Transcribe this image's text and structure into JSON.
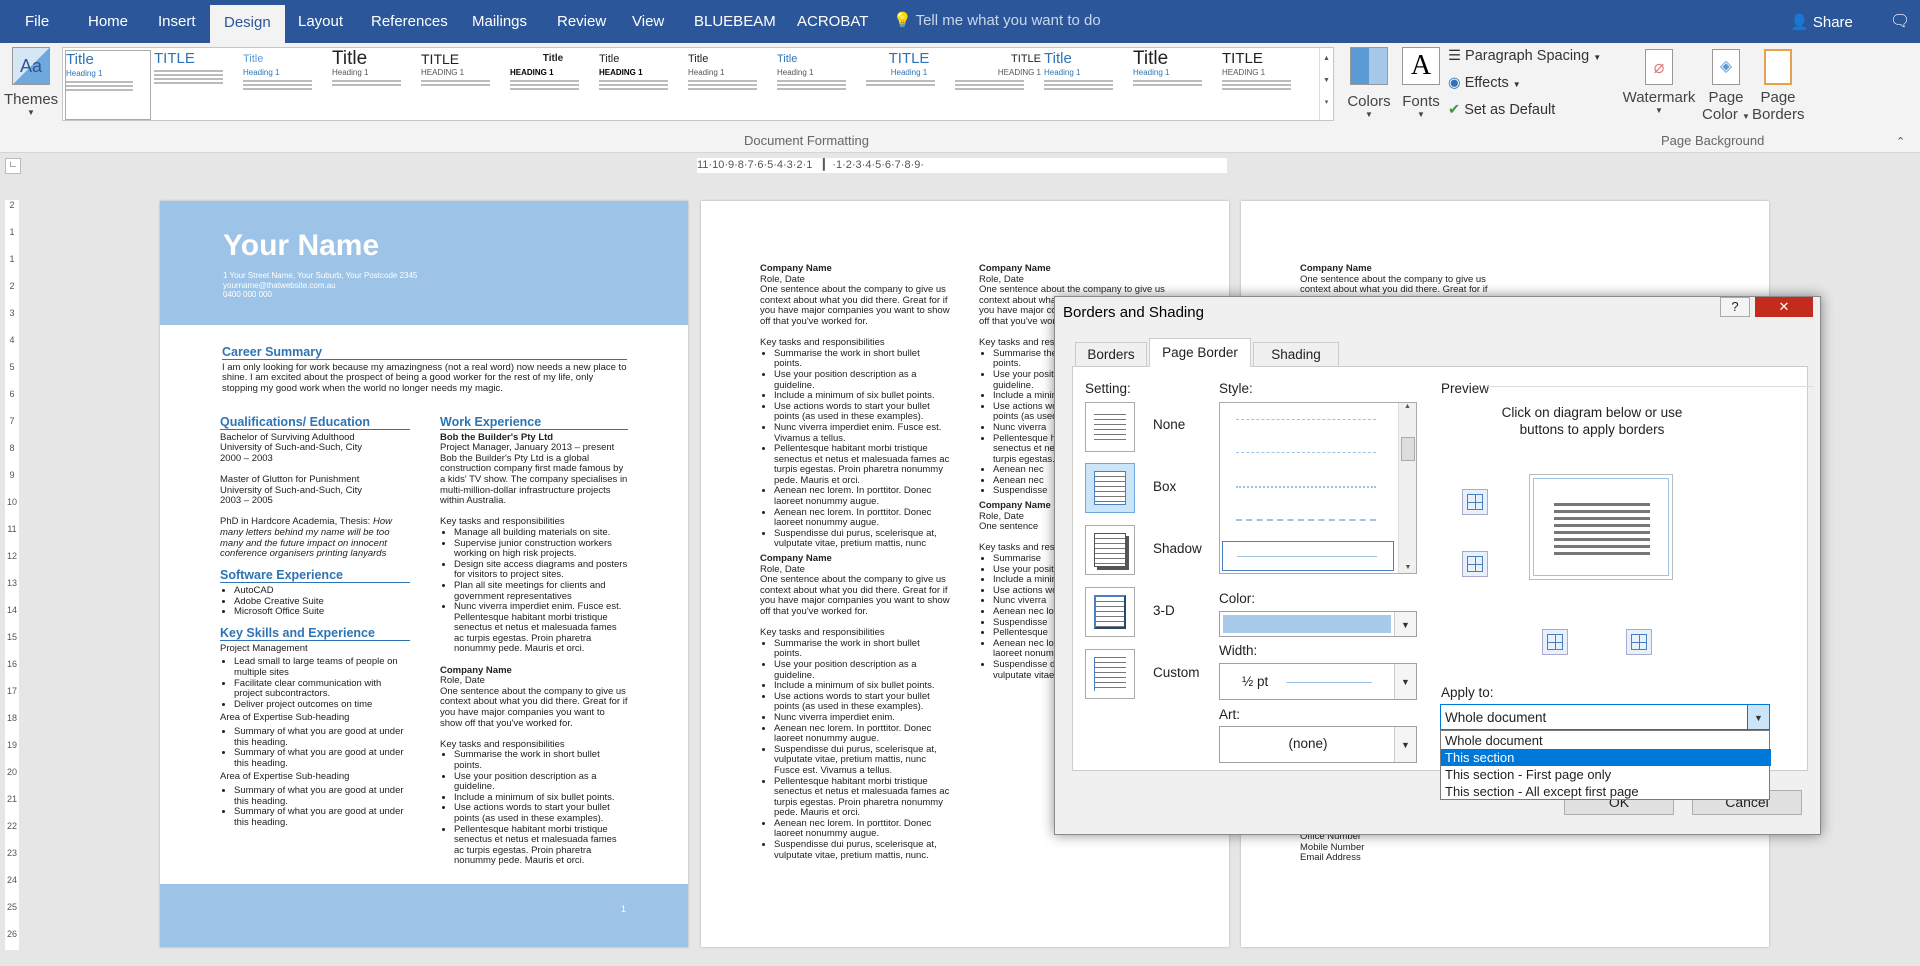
{
  "ribbon_tabs": [
    "File",
    "Home",
    "Insert",
    "Design",
    "Layout",
    "References",
    "Mailings",
    "Review",
    "View",
    "BLUEBEAM",
    "ACROBAT"
  ],
  "active_tab": "Design",
  "tell_me": "Tell me what you want to do",
  "share": "Share",
  "ribbon": {
    "themes": "Themes",
    "gallery_title": "Title",
    "gallery_title_caps": "TITLE",
    "gallery_heading": "Heading 1",
    "gallery_heading_caps": "HEADING 1",
    "colors": "Colors",
    "fonts": "Fonts",
    "paragraph_spacing": "Paragraph Spacing",
    "effects": "Effects",
    "set_default": "Set as Default",
    "doc_formatting_label": "Document Formatting",
    "watermark": "Watermark",
    "page_color_1": "Page",
    "page_color_2": "Color",
    "page_borders_1": "Page",
    "page_borders_2": "Borders",
    "page_background_label": "Page Background"
  },
  "ruler_text": "11·10·9·8·7·6·5·4·3·2·1 ▕▏·1·2·3·4·5·6·7·8·9·",
  "page1": {
    "name": "Your Name",
    "address": "1 Your Street Name, Your Suburb, Your Postcode 2345",
    "email": "yourname@thatwebsite.com.au",
    "phone": "0400 000 000",
    "career_summary_h": "Career Summary",
    "career_summary": "I am only looking for work because my amazingness (not a real word) now needs a new place to shine. I am excited about the prospect of being a good worker for the rest of my life, only stopping my good work when the world no longer needs my magic.",
    "qual_h": "Qualifications/ Education",
    "qual_1": [
      "Bachelor of Surviving Adulthood",
      "University of Such-and-Such, City",
      "2000 – 2003"
    ],
    "qual_2": [
      "Master of Glutton for Punishment",
      "University of Such-and-Such, City",
      "2003 – 2005"
    ],
    "qual_3_prefix": "PhD in Hardcore Academia, Thesis: ",
    "qual_3_thesis": "How many letters behind my name will be too many and the future impact on innocent conference organisers printing lanyards",
    "software_h": "Software Experience",
    "software": [
      "AutoCAD",
      "Adobe Creative Suite",
      "Microsoft Office Suite"
    ],
    "skills_h": "Key Skills and Experience",
    "skills_sub1": "Project Management",
    "skills_list1": [
      "Lead small to large teams of people on multiple sites",
      "Facilitate clear communication with project subcontractors.",
      "Deliver project outcomes on time"
    ],
    "skills_sub2": "Area of Expertise Sub-heading",
    "skills_list2": [
      "Summary of what you are good at under this heading.",
      "Summary of what you are good at under this heading."
    ],
    "skills_sub3": "Area of Expertise Sub-heading",
    "skills_list3": [
      "Summary of what you are good at under this heading.",
      "Summary of what you are good at under this heading."
    ],
    "work_h": "Work Experience",
    "work_company": "Bob the Builder's Pty Ltd",
    "work_role": "Project Manager, January 2013 – present",
    "work_desc": "Bob the Builder's Pty Ltd is a global construction company first made famous by a kids' TV show. The company specialises in multi-million-dollar infrastructure projects within Australia.",
    "tasks_h": "Key tasks and responsibilities",
    "work_tasks": [
      "Manage all building materials on site.",
      "Supervise junior construction workers working on high risk projects.",
      "Design site access diagrams and posters for visitors to project sites.",
      "Plan all site meetings for clients and government representatives",
      "Nunc viverra imperdiet enim. Fusce est. Pellentesque habitant morbi tristique senectus et netus et malesuada fames ac turpis egestas. Proin pharetra nonummy pede. Mauris et orci."
    ],
    "company2": "Company Name",
    "role2": "Role, Date",
    "desc2": "One sentence about the company to give us context about what you did there. Great for if you have major companies you want to show off that you've worked for.",
    "tasks2": [
      "Summarise the work in short bullet points.",
      "Use your position description as a guideline.",
      "Include a minimum of six bullet points.",
      "Use actions words to start your bullet points (as used in these examples).",
      "Pellentesque habitant morbi tristique senectus et netus et malesuada fames ac turpis egestas. Proin pharetra nonummy pede. Mauris et orci."
    ],
    "page_num": "1"
  },
  "page2": {
    "company": "Company Name",
    "role": "Role, Date",
    "desc": "One sentence about the company to give us context about what you did there. Great for if you have major companies you want to show off that you've worked for.",
    "tasks_h": "Key tasks and responsibilities",
    "tasks_a": [
      "Summarise the work in short bullet points.",
      "Use your position description as a guideline.",
      "Include a minimum of six bullet points.",
      "Use actions words to start your bullet points (as used in these examples).",
      "Nunc viverra imperdiet enim. Fusce est. Vivamus a tellus.",
      "Pellentesque habitant morbi tristique senectus et netus et malesuada fames ac turpis egestas. Proin pharetra nonummy pede. Mauris et orci.",
      "Aenean nec lorem. In porttitor. Donec laoreet nonummy augue.",
      "Aenean nec lorem. In porttitor. Donec laoreet nonummy augue.",
      "Suspendisse dui purus, scelerisque at, vulputate vitae, pretium mattis, nunc"
    ],
    "tasks_b": [
      "Summarise the work in short bullet points.",
      "Use your position description as a guideline.",
      "Include a minimum of six bullet points.",
      "Use actions words to start your bullet points (as used in these examples).",
      "Nunc viverra imperdiet enim.",
      "Aenean nec lorem. In porttitor. Donec laoreet nonummy augue.",
      "Suspendisse dui purus, scelerisque at, vulputate vitae, pretium mattis, nunc Fusce est. Vivamus a tellus.",
      "Pellentesque habitant morbi tristique senectus et netus et malesuada fames ac turpis egestas. Proin pharetra nonummy pede. Mauris et orci.",
      "Aenean nec lorem. In porttitor. Donec laoreet nonummy augue.",
      "Suspendisse dui purus, scelerisque at, vulputate vitae, pretium mattis, nunc."
    ],
    "col2_cut": [
      "Company Name",
      "Role, Date",
      "One sentence about the company to give us context about what you did there. Great for if you have major companies you want to show off that you've worked for.",
      "Key tasks and resp",
      "Summarise the work in short bullet points.",
      "Use your position description as a guideline.",
      "Include a minimum",
      "Use actions words to start your bullet points (as used in these examples).",
      "Nunc viverra",
      "Pellentesque habitant morbi tristique senectus et netus et malesuada fames ac turpis egestas.",
      "Aenean nec",
      "Aenean nec",
      "Suspendisse",
      "Company Name",
      "Role, Date",
      "One sentence",
      "Key tasks and resp",
      "Summarise",
      "Use your position",
      "Include a minimum",
      "Use actions words",
      "Nunc viverra",
      "Aenean nec lorem.",
      "Suspendisse",
      "Pellentesque",
      "Aenean nec lorem. In porttitor. Donec laoreet nonummy augue.",
      "Suspendisse dui purus, scelerisque at, vulputate vitae, pretium mattis, nunc."
    ]
  },
  "page3": {
    "company": "Company Name",
    "desc": "One sentence about the company to give us context about what you did there. Great for if",
    "contact": [
      "Office Number",
      "Mobile Number",
      "Email Address"
    ]
  },
  "dialog": {
    "title": "Borders and Shading",
    "help": "?",
    "close": "✕",
    "tabs": [
      "Borders",
      "Page Border",
      "Shading"
    ],
    "active_tab": "Page Border",
    "setting_label": "Setting:",
    "settings": [
      "None",
      "Box",
      "Shadow",
      "3-D",
      "Custom"
    ],
    "selected_setting": "Box",
    "style_label": "Style:",
    "color_label": "Color:",
    "color_value": "#a9cbeb",
    "width_label": "Width:",
    "width_value": "½ pt",
    "art_label": "Art:",
    "art_value": "(none)",
    "preview_label": "Preview",
    "preview_hint": "Click on diagram below or use buttons to apply borders",
    "apply_label": "Apply to:",
    "apply_value": "Whole document",
    "apply_options": [
      "Whole document",
      "This section",
      "This section - First page only",
      "This section - All except first page"
    ],
    "highlighted_option": "This section",
    "ok": "OK",
    "cancel": "Cancel"
  },
  "colors": {
    "ribbon_blue": "#2b579a",
    "accent": "#2e74b5",
    "resume_header": "#9dc3e6",
    "highlight": "#0078d7"
  }
}
